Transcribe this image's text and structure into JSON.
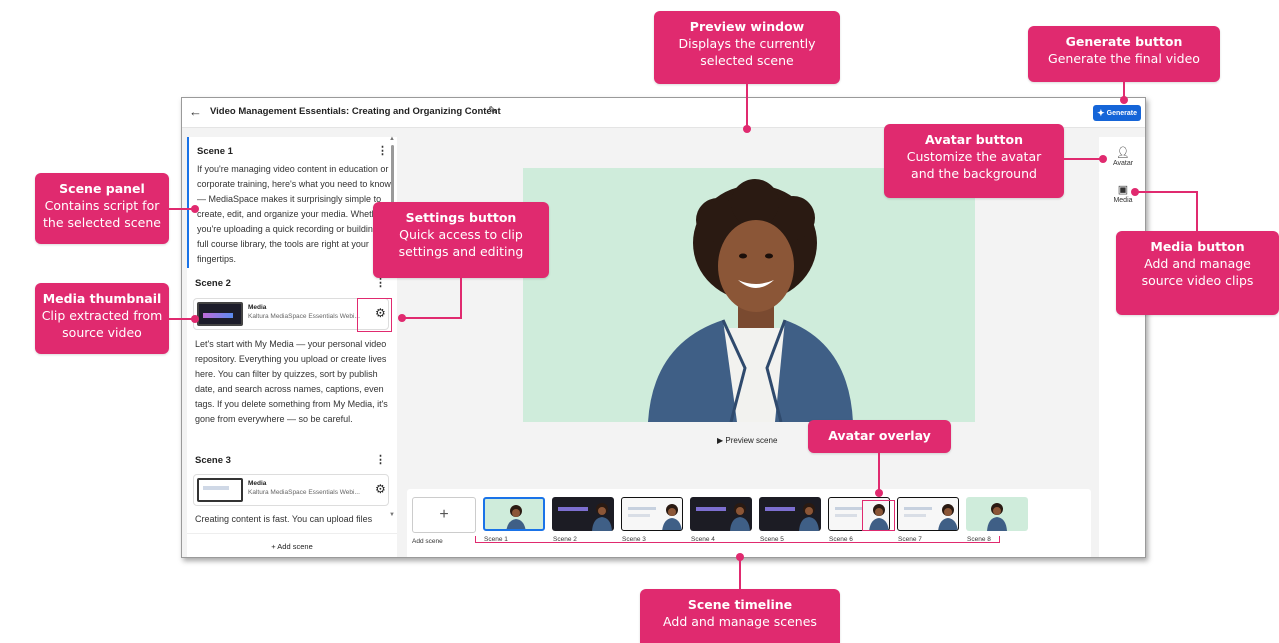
{
  "app": {
    "title": "Video Management Essentials: Creating and Organizing Content",
    "generate_label": "Generate"
  },
  "scenes": [
    {
      "label": "Scene 1",
      "text": "If you're managing video content in education or corporate training, here's what you need to know — MediaSpace makes it surprisingly simple to create, edit, and organize your media. Whether you're uploading a quick recording or building a full course library, the tools are right at your fingertips."
    },
    {
      "label": "Scene 2",
      "media_title": "Media",
      "media_source": "Kaltura MediaSpace Essentials Webi...",
      "text": "Let's start with My Media — your personal video repository. Everything you upload or create lives here. You can filter by quizzes, sort by publish date, and search across names, captions, even tags. If you delete something from My Media, it's gone from everywhere — so be careful."
    },
    {
      "label": "Scene 3",
      "media_title": "Media",
      "media_source": "Kaltura MediaSpace Essentials Webi...",
      "text": "Creating content is fast. You can upload files"
    }
  ],
  "add_scene_label": "+ Add scene",
  "preview": {
    "caption": "▶  Preview scene"
  },
  "rail": {
    "avatar_label": "Avatar",
    "media_label": "Media"
  },
  "timeline": {
    "add_tile_symbol": "+",
    "add_label": "Add scene",
    "items": [
      {
        "label": "Scene 1",
        "kind": "green"
      },
      {
        "label": "Scene 2",
        "kind": "dark"
      },
      {
        "label": "Scene 3",
        "kind": "white"
      },
      {
        "label": "Scene 4",
        "kind": "dark"
      },
      {
        "label": "Scene 5",
        "kind": "dark"
      },
      {
        "label": "Scene 6",
        "kind": "white"
      },
      {
        "label": "Scene 7",
        "kind": "white"
      },
      {
        "label": "Scene 8",
        "kind": "green"
      }
    ]
  },
  "annotations": {
    "preview_window": {
      "title": "Preview window",
      "desc": "Displays the currently selected scene"
    },
    "generate_button": {
      "title": "Generate button",
      "desc": "Generate the final video"
    },
    "avatar_button": {
      "title": "Avatar button",
      "desc": "Customize the avatar and the background"
    },
    "scene_panel": {
      "title": "Scene panel",
      "desc": "Contains script for the selected scene"
    },
    "settings_button": {
      "title": "Settings button",
      "desc": "Quick access to clip settings and editing"
    },
    "media_button": {
      "title": "Media button",
      "desc": "Add and manage source video clips"
    },
    "media_thumbnail": {
      "title": "Media thumbnail",
      "desc": "Clip extracted from source video"
    },
    "avatar_overlay": {
      "title": "Avatar overlay"
    },
    "scene_timeline": {
      "title": "Scene timeline",
      "desc": "Add and manage scenes"
    }
  },
  "colors": {
    "accent": "#e02a6f",
    "primary": "#1565d8",
    "preview_bg": "#cfecdb"
  }
}
